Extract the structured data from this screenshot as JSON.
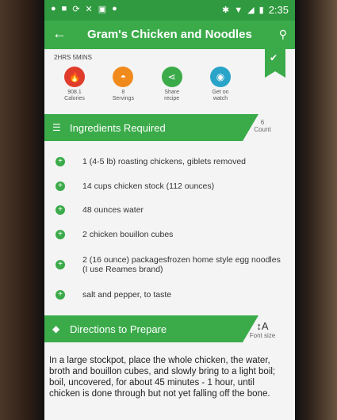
{
  "status_bar": {
    "time": "2:35"
  },
  "app_bar": {
    "title": "Gram's Chicken and Noodles"
  },
  "recipe": {
    "total_time": "2HRS 5MINS",
    "stats": [
      {
        "value": "908.1",
        "label": "Calories",
        "color": "#e03c2c",
        "icon": "flame-icon"
      },
      {
        "value": "8",
        "label": "Servings",
        "color": "#f08a1c",
        "icon": "dish-icon"
      },
      {
        "value": "Share",
        "label": "recipe",
        "color": "#3bab4a",
        "icon": "share-icon"
      },
      {
        "value": "Get on",
        "label": "watch",
        "color": "#29a4c8",
        "icon": "watch-icon"
      }
    ]
  },
  "ingredients_section": {
    "title": "Ingredients Required",
    "count": "6",
    "count_label": "Count"
  },
  "ingredients": [
    "1 (4-5 lb) roasting chickens, giblets removed",
    "14 cups chicken stock (112 ounces)",
    "48 ounces water",
    "2 chicken bouillon cubes",
    "2 (16 ounce) packagesfrozen home style egg noodles (I use Reames brand)",
    "salt and pepper, to taste"
  ],
  "directions_section": {
    "title": "Directions to Prepare",
    "font_size_label": "Font size"
  },
  "directions_text": "In a large stockpot, place the whole chicken, the water, broth and bouillon cubes, and slowly bring to a light boil; boil, uncovered, for about 45 minutes - 1 hour, until chicken is done through but not yet falling off the bone."
}
